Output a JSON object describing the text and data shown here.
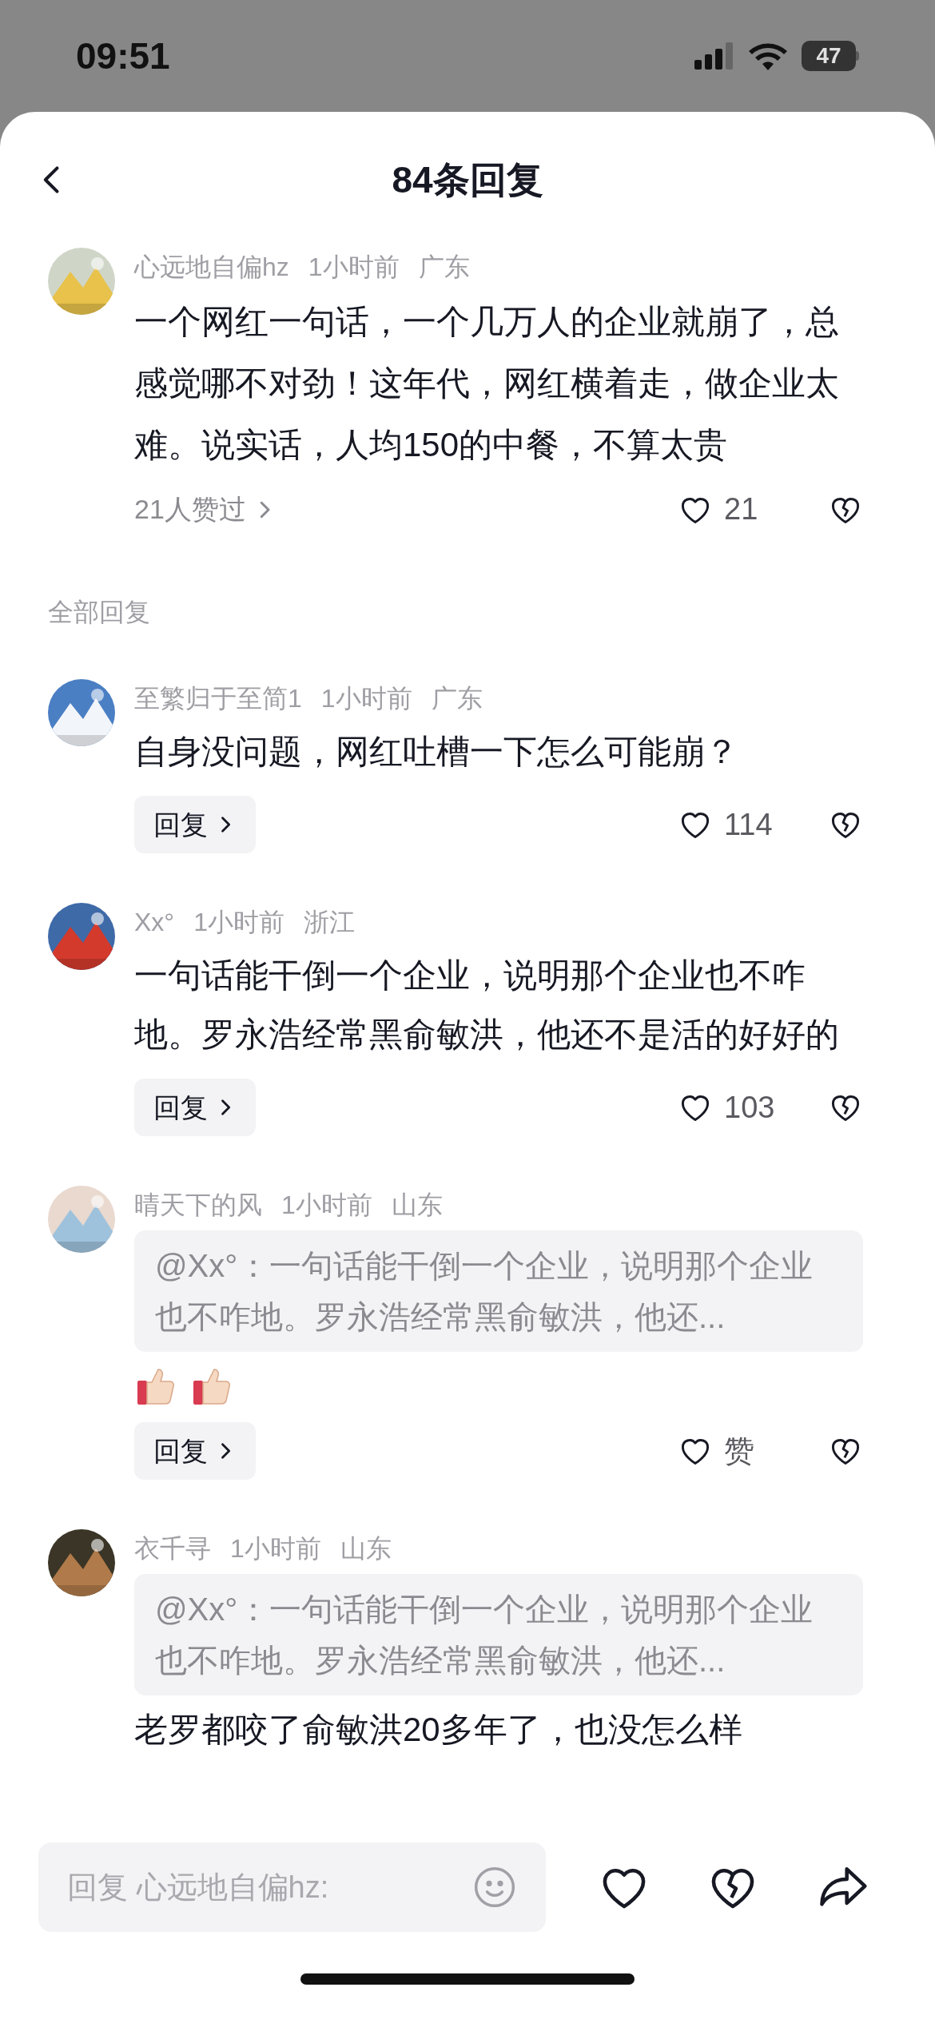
{
  "status_bar": {
    "time": "09:51",
    "battery": "47"
  },
  "header": {
    "title": "84条回复"
  },
  "main_comment": {
    "author": "心远地自偏hz",
    "time": "1小时前",
    "location": "广东",
    "text": "一个网红一句话，一个几万人的企业就崩了，总感觉哪不对劲！这年代，网红横着走，做企业太难。说实话，人均150的中餐，不算太贵",
    "liked_by": "21人赞过",
    "likes": "21"
  },
  "section_label": "全部回复",
  "replies": [
    {
      "author": "至繁归于至简1",
      "time": "1小时前",
      "location": "广东",
      "text": "自身没问题，网红吐槽一下怎么可能崩？",
      "reply_label": "回复",
      "likes": "114"
    },
    {
      "author": "Xx°",
      "time": "1小时前",
      "location": "浙江",
      "text": "一句话能干倒一个企业，说明那个企业也不咋地。罗永浩经常黑俞敏洪，他还不是活的好好的",
      "reply_label": "回复",
      "likes": "103"
    },
    {
      "author": "晴天下的风",
      "time": "1小时前",
      "location": "山东",
      "quote": "@Xx°：一句话能干倒一个企业，说明那个企业也不咋地。罗永浩经常黑俞敏洪，他还...",
      "stickers": [
        {
          "kind": "thumbs_up"
        },
        {
          "kind": "thumbs_up"
        }
      ],
      "reply_label": "回复",
      "likes": "赞"
    },
    {
      "author": "衣千寻",
      "time": "1小时前",
      "location": "山东",
      "quote": "@Xx°：一句话能干倒一个企业，说明那个企业也不咋地。罗永浩经常黑俞敏洪，他还...",
      "text": "老罗都咬了俞敏洪20多年了，也没怎么样"
    }
  ],
  "composer": {
    "placeholder": "回复 心远地自偏hz:"
  }
}
